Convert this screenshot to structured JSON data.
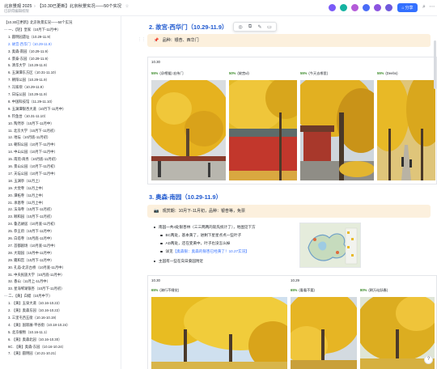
{
  "header": {
    "breadcrumb_root": "北京景观 2025",
    "breadcrumb_current": "【10.30已更新】北京秋景实况——50个实况",
    "subline": "已获得编辑权限",
    "share_label": "分享",
    "share_icon": "lock-icon",
    "avatar_colors": [
      "#7a5af8",
      "#15b3a1",
      "#b45bd8",
      "#4a6cf7",
      "#8c54e0",
      "#6f59dc"
    ]
  },
  "sidebar": {
    "items": [
      {
        "label": "【10.30已更新】北京秋景实况——50个实况",
        "level": 0
      },
      {
        "label": "一、【轻】皇家（10月下-11月中）",
        "level": 1,
        "caret": "—"
      },
      {
        "label": "1. 圆明园遗址（10.29-11.9）",
        "level": 2
      },
      {
        "label": "2. 故宫-西华门（10.29-11.9）",
        "level": 2,
        "active": true
      },
      {
        "label": "3. 奥森-南园（10.29-11.9）",
        "level": 2
      },
      {
        "label": "4. 景泰-东园（10.29-11.9）",
        "level": 2
      },
      {
        "label": "5. 清华大学（10.29-11.9）",
        "level": 2
      },
      {
        "label": "6. 玉渊潭东方区（10.31-11.10）",
        "level": 2
      },
      {
        "label": "7. 朝阳公园（10.29-11.9）",
        "level": 2
      },
      {
        "label": "7. 冯家坝（10.29-11.9）",
        "level": 2
      },
      {
        "label": "7. 日坛公园（10.29-11.9）",
        "level": 2
      },
      {
        "label": "8. 中国科技馆（11.29-11.10）",
        "level": 2
      },
      {
        "label": "9. 玉渊潭银杏大道（10月下-11月中）",
        "level": 2
      },
      {
        "label": "9. 钓鱼台（10.31-11.10）",
        "level": 2
      },
      {
        "label": "10. 陶然亭（10月下-11月中）",
        "level": 2
      },
      {
        "label": "11. 北京大学（10月下-11月初）",
        "level": 2
      },
      {
        "label": "12. 地坛（10月底-11月初）",
        "level": 2
      },
      {
        "label": "13. 朝阳公园（10月下-11月中）",
        "level": 2
      },
      {
        "label": "14. 中山公园（10月下-11月中）",
        "level": 2
      },
      {
        "label": "15. 南苑-商务（10月底-11月初）",
        "level": 2
      },
      {
        "label": "16. 景山公园（10月下-11月初）",
        "level": 2
      },
      {
        "label": "17. 天坛公园（10月下-11月中）",
        "level": 2
      },
      {
        "label": "18. 玉渊亭（11月上）",
        "level": 2
      },
      {
        "label": "19. 大觉寺（11月上中）",
        "level": 2
      },
      {
        "label": "20. 潭柘寺（11月上中）",
        "level": 2
      },
      {
        "label": "21. 承恩寺（11月上中）",
        "level": 2
      },
      {
        "label": "22. 法海寺（10月下-11月初）",
        "level": 2
      },
      {
        "label": "23. 颐和园（10月下-11月初）",
        "level": 2
      },
      {
        "label": "24. 鲁迅故居（10月底-11月初）",
        "level": 2
      },
      {
        "label": "25. 恭王府（10月下-11月中）",
        "level": 2
      },
      {
        "label": "26. 白塔寺（10月底-11月中）",
        "level": 2
      },
      {
        "label": "27. 首都剧场（10月底-11月中）",
        "level": 2
      },
      {
        "label": "28. 大观园（10月中-11月中）",
        "level": 2
      },
      {
        "label": "29. 雍和宫（10月下-11月中）",
        "level": 2
      },
      {
        "label": "30. 孔庙-北京古桥（10月底-11月中）",
        "level": 2
      },
      {
        "label": "31. 中央民族大学（10月底-11月中）",
        "level": 2
      },
      {
        "label": "32. 香山（11月上-11月中）",
        "level": 2
      },
      {
        "label": "33. 星海琴湖银杏（10月下-11月初）",
        "level": 2
      },
      {
        "label": "二、【黄】白蜡（10月中下）",
        "level": 1,
        "caret": "—"
      },
      {
        "label": "1. 【黄】玉泉大道（10.16-10.22）",
        "level": 2
      },
      {
        "label": "2. 【黄】奥森东园（10.16-10.22）",
        "level": 2
      },
      {
        "label": "3. 三里屯西五街（10.16-10.19）",
        "level": 2
      },
      {
        "label": "4. 【黄】国际展-平谷街（10.18-10.24）",
        "level": 2
      },
      {
        "label": "5. 北京植物（10.16-11.1）",
        "level": 2
      },
      {
        "label": "6. 【黄】奥森北园（10.16-10.30）",
        "level": 2
      },
      {
        "label": "6C. 【黄】奥森-东园（10.16-10.24）",
        "level": 2
      },
      {
        "label": "7. 【黄】圆明园（10.21-10.21）",
        "level": 2
      }
    ]
  },
  "float_toolbar": {
    "icons": [
      "comment-icon",
      "copy-icon",
      "edit-icon",
      "more-icon"
    ],
    "glyphs": [
      "◎",
      "⧉",
      "✎",
      "▭"
    ]
  },
  "section1": {
    "heading": "2. 故宫-西华门（10.29-11.9）",
    "callout_icon": "pin-icon",
    "callout_text": "品种：银杏、西华门",
    "date": "10.30",
    "photos": [
      {
        "pct": "55%",
        "caption": "(@喂猫) 宏伟门"
      },
      {
        "pct": "50%",
        "caption": "(故宫ul)"
      },
      {
        "pct": "55%",
        "caption": "(今天去哪里)"
      },
      {
        "pct": "55%",
        "caption": "(Deebo)"
      }
    ]
  },
  "section2": {
    "heading": "3. 奥森-南园（10.29-11.9）",
    "callout_icon": "camera-icon",
    "callout_text": "观赏期：10月下-11月初，品种：银杏等，免票",
    "bullets": [
      {
        "text": "南园一共4处银杏林（三三两两的就先统计了），地图见下方",
        "level": 1
      },
      {
        "text": "BC两处，基本黄了，进剩下星星点点一些叶子",
        "level": 2
      },
      {
        "text": "AD两处，还在变黄中，叶子也没怎么掉",
        "level": 2
      },
      {
        "text_prefix": "详见",
        "link": "【奥森银：奥森的银杏已经黄了！10.27实况】",
        "level": 2
      },
      {
        "text": "主园有一些在向日葵园附近",
        "level": 1
      }
    ],
    "date": "10.30",
    "date2": "10.29",
    "photos": [
      {
        "pct": "65%",
        "caption": "(骑行不睡觉)"
      },
      {
        "pct": "65%",
        "caption": "(看看不要)"
      },
      {
        "pct": "80%",
        "caption": "(朝万站跃春)"
      }
    ]
  }
}
